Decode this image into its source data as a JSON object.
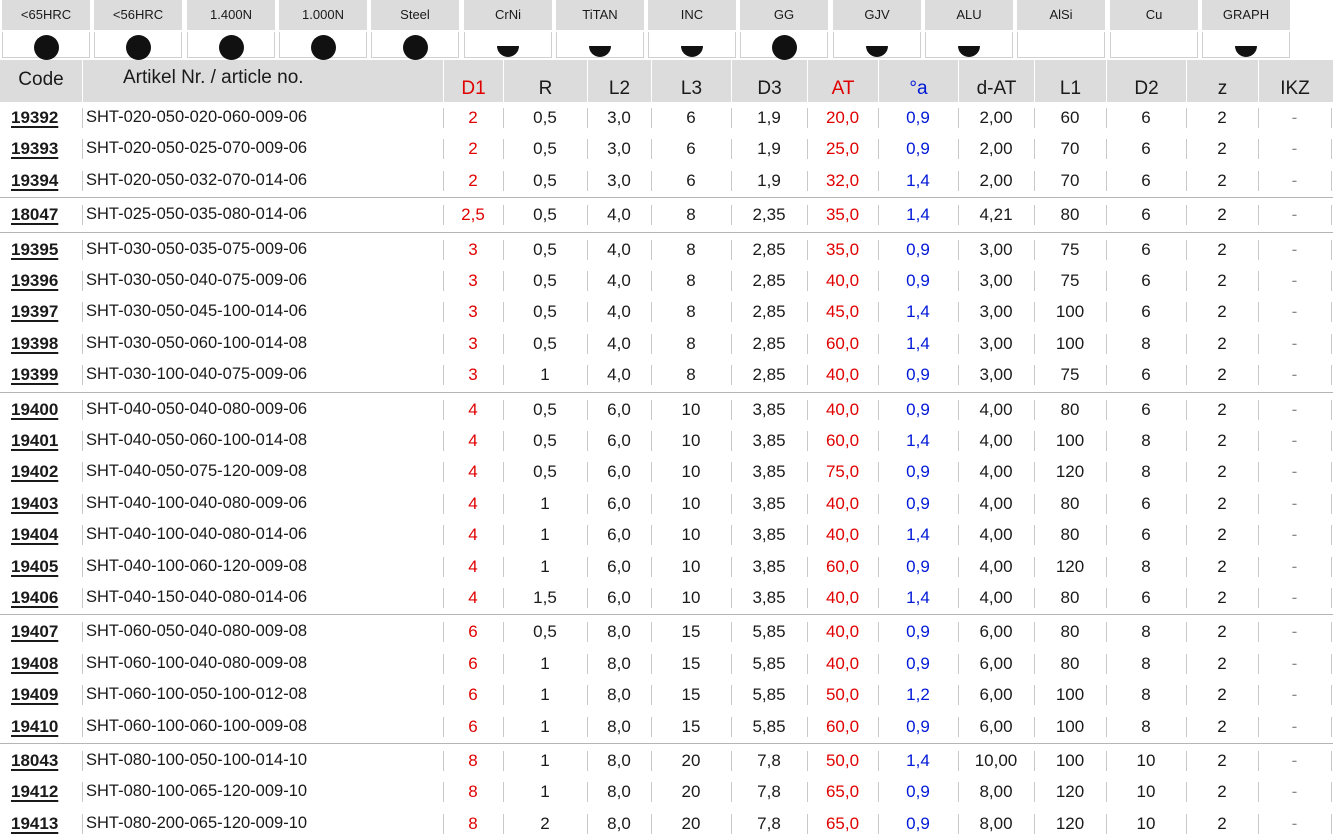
{
  "materials": [
    {
      "label": "<65HRC",
      "mark": "dot"
    },
    {
      "label": "<56HRC",
      "mark": "dot"
    },
    {
      "label": "1.400N",
      "mark": "dot"
    },
    {
      "label": "1.000N",
      "mark": "dot"
    },
    {
      "label": "Steel",
      "mark": "dot"
    },
    {
      "label": "CrNi",
      "mark": "half"
    },
    {
      "label": "TiTAN",
      "mark": "half"
    },
    {
      "label": "INC",
      "mark": "half"
    },
    {
      "label": "GG",
      "mark": "dot"
    },
    {
      "label": "GJV",
      "mark": "half"
    },
    {
      "label": "ALU",
      "mark": "half"
    },
    {
      "label": "AlSi",
      "mark": "none"
    },
    {
      "label": "Cu",
      "mark": "none"
    },
    {
      "label": "GRAPH",
      "mark": "half"
    }
  ],
  "columns": {
    "code": "Code",
    "article": "Artikel Nr. / article no.",
    "d1": "D1",
    "r": "R",
    "l2": "L2",
    "l3": "L3",
    "d3": "D3",
    "at": "AT",
    "angle": "°a",
    "dat": "d-AT",
    "l1": "L1",
    "d2": "D2",
    "z": "z",
    "ikz": "IKZ"
  },
  "rows": [
    {
      "code": "19392",
      "article": "SHT-020-050-020-060-009-06",
      "d1": "2",
      "r": "0,5",
      "l2": "3,0",
      "l3": "6",
      "d3": "1,9",
      "at": "20,0",
      "angle": "0,9",
      "dat": "2,00",
      "l1": "60",
      "d2": "6",
      "z": "2",
      "ikz": "-"
    },
    {
      "code": "19393",
      "article": "SHT-020-050-025-070-009-06",
      "d1": "2",
      "r": "0,5",
      "l2": "3,0",
      "l3": "6",
      "d3": "1,9",
      "at": "25,0",
      "angle": "0,9",
      "dat": "2,00",
      "l1": "70",
      "d2": "6",
      "z": "2",
      "ikz": "-"
    },
    {
      "code": "19394",
      "article": "SHT-020-050-032-070-014-06",
      "d1": "2",
      "r": "0,5",
      "l2": "3,0",
      "l3": "6",
      "d3": "1,9",
      "at": "32,0",
      "angle": "1,4",
      "dat": "2,00",
      "l1": "70",
      "d2": "6",
      "z": "2",
      "ikz": "-"
    },
    {
      "code": "18047",
      "article": "SHT-025-050-035-080-014-06",
      "d1": "2,5",
      "r": "0,5",
      "l2": "4,0",
      "l3": "8",
      "d3": "2,35",
      "at": "35,0",
      "angle": "1,4",
      "dat": "4,21",
      "l1": "80",
      "d2": "6",
      "z": "2",
      "ikz": "-",
      "group": true
    },
    {
      "code": "19395",
      "article": "SHT-030-050-035-075-009-06",
      "d1": "3",
      "r": "0,5",
      "l2": "4,0",
      "l3": "8",
      "d3": "2,85",
      "at": "35,0",
      "angle": "0,9",
      "dat": "3,00",
      "l1": "75",
      "d2": "6",
      "z": "2",
      "ikz": "-",
      "group": true
    },
    {
      "code": "19396",
      "article": "SHT-030-050-040-075-009-06",
      "d1": "3",
      "r": "0,5",
      "l2": "4,0",
      "l3": "8",
      "d3": "2,85",
      "at": "40,0",
      "angle": "0,9",
      "dat": "3,00",
      "l1": "75",
      "d2": "6",
      "z": "2",
      "ikz": "-"
    },
    {
      "code": "19397",
      "article": "SHT-030-050-045-100-014-06",
      "d1": "3",
      "r": "0,5",
      "l2": "4,0",
      "l3": "8",
      "d3": "2,85",
      "at": "45,0",
      "angle": "1,4",
      "dat": "3,00",
      "l1": "100",
      "d2": "6",
      "z": "2",
      "ikz": "-"
    },
    {
      "code": "19398",
      "article": "SHT-030-050-060-100-014-08",
      "d1": "3",
      "r": "0,5",
      "l2": "4,0",
      "l3": "8",
      "d3": "2,85",
      "at": "60,0",
      "angle": "1,4",
      "dat": "3,00",
      "l1": "100",
      "d2": "8",
      "z": "2",
      "ikz": "-"
    },
    {
      "code": "19399",
      "article": "SHT-030-100-040-075-009-06",
      "d1": "3",
      "r": "1",
      "l2": "4,0",
      "l3": "8",
      "d3": "2,85",
      "at": "40,0",
      "angle": "0,9",
      "dat": "3,00",
      "l1": "75",
      "d2": "6",
      "z": "2",
      "ikz": "-"
    },
    {
      "code": "19400",
      "article": "SHT-040-050-040-080-009-06",
      "d1": "4",
      "r": "0,5",
      "l2": "6,0",
      "l3": "10",
      "d3": "3,85",
      "at": "40,0",
      "angle": "0,9",
      "dat": "4,00",
      "l1": "80",
      "d2": "6",
      "z": "2",
      "ikz": "-",
      "group": true
    },
    {
      "code": "19401",
      "article": "SHT-040-050-060-100-014-08",
      "d1": "4",
      "r": "0,5",
      "l2": "6,0",
      "l3": "10",
      "d3": "3,85",
      "at": "60,0",
      "angle": "1,4",
      "dat": "4,00",
      "l1": "100",
      "d2": "8",
      "z": "2",
      "ikz": "-"
    },
    {
      "code": "19402",
      "article": "SHT-040-050-075-120-009-08",
      "d1": "4",
      "r": "0,5",
      "l2": "6,0",
      "l3": "10",
      "d3": "3,85",
      "at": "75,0",
      "angle": "0,9",
      "dat": "4,00",
      "l1": "120",
      "d2": "8",
      "z": "2",
      "ikz": "-"
    },
    {
      "code": "19403",
      "article": "SHT-040-100-040-080-009-06",
      "d1": "4",
      "r": "1",
      "l2": "6,0",
      "l3": "10",
      "d3": "3,85",
      "at": "40,0",
      "angle": "0,9",
      "dat": "4,00",
      "l1": "80",
      "d2": "6",
      "z": "2",
      "ikz": "-"
    },
    {
      "code": "19404",
      "article": "SHT-040-100-040-080-014-06",
      "d1": "4",
      "r": "1",
      "l2": "6,0",
      "l3": "10",
      "d3": "3,85",
      "at": "40,0",
      "angle": "1,4",
      "dat": "4,00",
      "l1": "80",
      "d2": "6",
      "z": "2",
      "ikz": "-"
    },
    {
      "code": "19405",
      "article": "SHT-040-100-060-120-009-08",
      "d1": "4",
      "r": "1",
      "l2": "6,0",
      "l3": "10",
      "d3": "3,85",
      "at": "60,0",
      "angle": "0,9",
      "dat": "4,00",
      "l1": "120",
      "d2": "8",
      "z": "2",
      "ikz": "-"
    },
    {
      "code": "19406",
      "article": "SHT-040-150-040-080-014-06",
      "d1": "4",
      "r": "1,5",
      "l2": "6,0",
      "l3": "10",
      "d3": "3,85",
      "at": "40,0",
      "angle": "1,4",
      "dat": "4,00",
      "l1": "80",
      "d2": "6",
      "z": "2",
      "ikz": "-"
    },
    {
      "code": "19407",
      "article": "SHT-060-050-040-080-009-08",
      "d1": "6",
      "r": "0,5",
      "l2": "8,0",
      "l3": "15",
      "d3": "5,85",
      "at": "40,0",
      "angle": "0,9",
      "dat": "6,00",
      "l1": "80",
      "d2": "8",
      "z": "2",
      "ikz": "-",
      "group": true
    },
    {
      "code": "19408",
      "article": "SHT-060-100-040-080-009-08",
      "d1": "6",
      "r": "1",
      "l2": "8,0",
      "l3": "15",
      "d3": "5,85",
      "at": "40,0",
      "angle": "0,9",
      "dat": "6,00",
      "l1": "80",
      "d2": "8",
      "z": "2",
      "ikz": "-"
    },
    {
      "code": "19409",
      "article": "SHT-060-100-050-100-012-08",
      "d1": "6",
      "r": "1",
      "l2": "8,0",
      "l3": "15",
      "d3": "5,85",
      "at": "50,0",
      "angle": "1,2",
      "dat": "6,00",
      "l1": "100",
      "d2": "8",
      "z": "2",
      "ikz": "-"
    },
    {
      "code": "19410",
      "article": "SHT-060-100-060-100-009-08",
      "d1": "6",
      "r": "1",
      "l2": "8,0",
      "l3": "15",
      "d3": "5,85",
      "at": "60,0",
      "angle": "0,9",
      "dat": "6,00",
      "l1": "100",
      "d2": "8",
      "z": "2",
      "ikz": "-"
    },
    {
      "code": "18043",
      "article": "SHT-080-100-050-100-014-10",
      "d1": "8",
      "r": "1",
      "l2": "8,0",
      "l3": "20",
      "d3": "7,8",
      "at": "50,0",
      "angle": "1,4",
      "dat": "10,00",
      "l1": "100",
      "d2": "10",
      "z": "2",
      "ikz": "-",
      "group": true
    },
    {
      "code": "19412",
      "article": "SHT-080-100-065-120-009-10",
      "d1": "8",
      "r": "1",
      "l2": "8,0",
      "l3": "20",
      "d3": "7,8",
      "at": "65,0",
      "angle": "0,9",
      "dat": "8,00",
      "l1": "120",
      "d2": "10",
      "z": "2",
      "ikz": "-"
    },
    {
      "code": "19413",
      "article": "SHT-080-200-065-120-009-10",
      "d1": "8",
      "r": "2",
      "l2": "8,0",
      "l3": "20",
      "d3": "7,8",
      "at": "65,0",
      "angle": "0,9",
      "dat": "8,00",
      "l1": "120",
      "d2": "10",
      "z": "2",
      "ikz": "-"
    }
  ],
  "colors": {
    "accent_red": "#e00000",
    "accent_blue": "#0018d8",
    "header_gray": "#dcdcdc"
  }
}
